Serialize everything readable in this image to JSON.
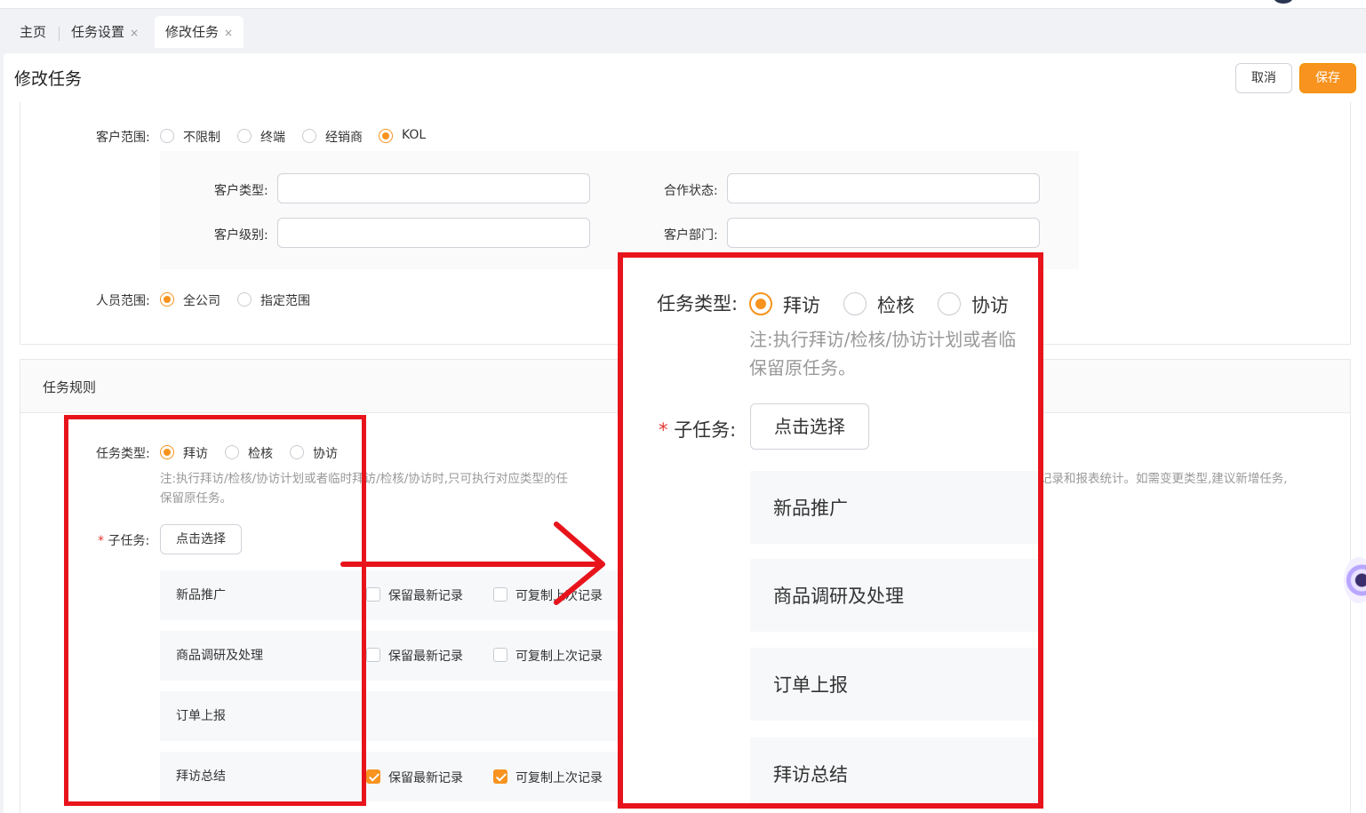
{
  "tabs": [
    {
      "label": "主页",
      "closable": false,
      "active": false
    },
    {
      "label": "任务设置",
      "closable": true,
      "active": false
    },
    {
      "label": "修改任务",
      "closable": true,
      "active": true
    }
  ],
  "tab_close_glyph": "×",
  "header": {
    "title": "修改任务",
    "cancel_label": "取消",
    "save_label": "保存"
  },
  "customer_scope": {
    "label": "客户范围:",
    "options": [
      "不限制",
      "终端",
      "经销商",
      "KOL"
    ],
    "selected": "KOL",
    "fields": {
      "customer_type": {
        "label": "客户类型:",
        "value": ""
      },
      "cooperation_status": {
        "label": "合作状态:",
        "value": ""
      },
      "customer_level": {
        "label": "客户级别:",
        "value": ""
      },
      "customer_department": {
        "label": "客户部门:",
        "value": ""
      }
    }
  },
  "staff_scope": {
    "label": "人员范围:",
    "options": [
      "全公司",
      "指定范围"
    ],
    "selected": "全公司"
  },
  "rules": {
    "section_title": "任务规则",
    "task_type": {
      "label": "任务类型:",
      "options": [
        "拜访",
        "检核",
        "协访"
      ],
      "selected": "拜访"
    },
    "note": "注:执行拜访/检核/协访计划或者临时拜访/检核/协访时,只可执行对应类型的任",
    "note_tail": "记录和报表统计。如需变更类型,建议新增任务,",
    "note_line2": "保留原任务。",
    "subtask": {
      "required_mark": "*",
      "label": "子任务:",
      "button": "点击选择"
    },
    "subtasks": [
      {
        "name": "新品推广",
        "keep_latest_label": "保留最新记录",
        "keep_latest": false,
        "copy_last_label": "可复制上次记录",
        "copy_last": false
      },
      {
        "name": "商品调研及处理",
        "keep_latest_label": "保留最新记录",
        "keep_latest": false,
        "copy_last_label": "可复制上次记录",
        "copy_last": false
      },
      {
        "name": "订单上报"
      },
      {
        "name": "拜访总结",
        "keep_latest_label": "保留最新记录",
        "keep_latest": true,
        "copy_last_label": "可复制上次记录",
        "copy_last": true
      }
    ]
  },
  "zoom": {
    "task_type_label": "任务类型:",
    "options": [
      "拜访",
      "检核",
      "协访"
    ],
    "selected": "拜访",
    "note_line1": "注:执行拜访/检核/协访计划或者临",
    "note_line2": "保留原任务。",
    "required_mark": "*",
    "subtask_label": "子任务:",
    "button": "点击选择",
    "subtasks": [
      "新品推广",
      "商品调研及处理",
      "订单上报",
      "拜访总结"
    ]
  },
  "colors": {
    "accent": "#f7931e",
    "highlight_red": "#e8141c"
  },
  "icons": {
    "close": "close-icon",
    "check": "check-icon",
    "arrow": "arrow-right-icon"
  }
}
